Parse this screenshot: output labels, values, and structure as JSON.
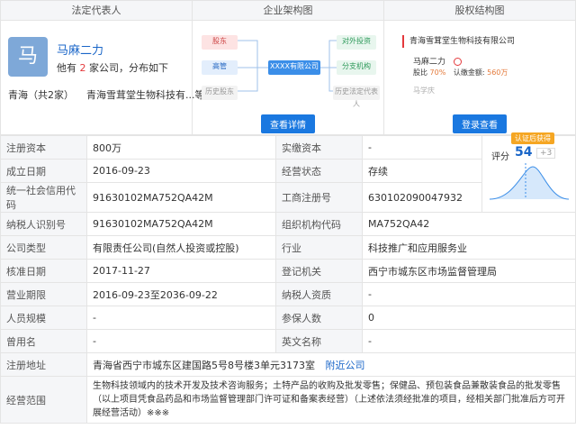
{
  "tabs": {
    "legal_rep": "法定代表人",
    "org_chart": "企业架构图",
    "equity_chart": "股权结构图"
  },
  "legal_rep": {
    "avatar_char": "马",
    "name": "马麻二力",
    "companies_pre": "他有",
    "companies_count": "2",
    "companies_post": "家公司，分布如下",
    "region": "青海（共2家）",
    "company_short": "青海雪茸堂生物科技有...等"
  },
  "org": {
    "shareholder": "股东",
    "executive": "高管",
    "history_shareholder": "历史股东",
    "center": "XXXX有限公司",
    "outbound": "对外投资",
    "branch": "分支机构",
    "history_rep": "历史法定代表人",
    "detail_btn": "查看详情"
  },
  "equity": {
    "company": "青海雪茸堂生物科技有限公司",
    "holder": "马麻二力",
    "ratio_label": "股比",
    "ratio": "70%",
    "amount_label": "认缴金额",
    "amount": "560万",
    "other_holder": "马学庆",
    "login_btn": "登录查看"
  },
  "score": {
    "label": "评分",
    "value": "54",
    "delta": "+3",
    "badge": "认证后获得"
  },
  "rows": [
    [
      "注册资本",
      "800万",
      "实缴资本",
      "-"
    ],
    [
      "成立日期",
      "2016-09-23",
      "经营状态",
      "存续"
    ],
    [
      "统一社会信用代码",
      "91630102MA752QA42M",
      "工商注册号",
      "630102090047932"
    ],
    [
      "纳税人识别号",
      "91630102MA752QA42M",
      "组织机构代码",
      "MA752QA42"
    ],
    [
      "公司类型",
      "有限责任公司(自然人投资或控股)",
      "行业",
      "科技推广和应用服务业"
    ],
    [
      "核准日期",
      "2017-11-27",
      "登记机关",
      "西宁市城东区市场监督管理局"
    ],
    [
      "营业期限",
      "2016-09-23至2036-09-22",
      "纳税人资质",
      "-"
    ],
    [
      "人员规模",
      "-",
      "参保人数",
      "0"
    ],
    [
      "曾用名",
      "-",
      "英文名称",
      "-"
    ]
  ],
  "address": {
    "label": "注册地址",
    "value": "青海省西宁市城东区建国路5号8号楼3单元3173室",
    "link": "附近公司"
  },
  "scope": {
    "label": "经营范围",
    "value": "生物科技领域内的技术开发及技术咨询服务；土特产品的收购及批发零售；保健品、预包装食品兼散装食品的批发零售（以上项目凭食品药品和市场监督管理部门许可证和备案表经营）（上述依法须经批准的项目，经相关部门批准后方可开展经营活动）※※※"
  }
}
